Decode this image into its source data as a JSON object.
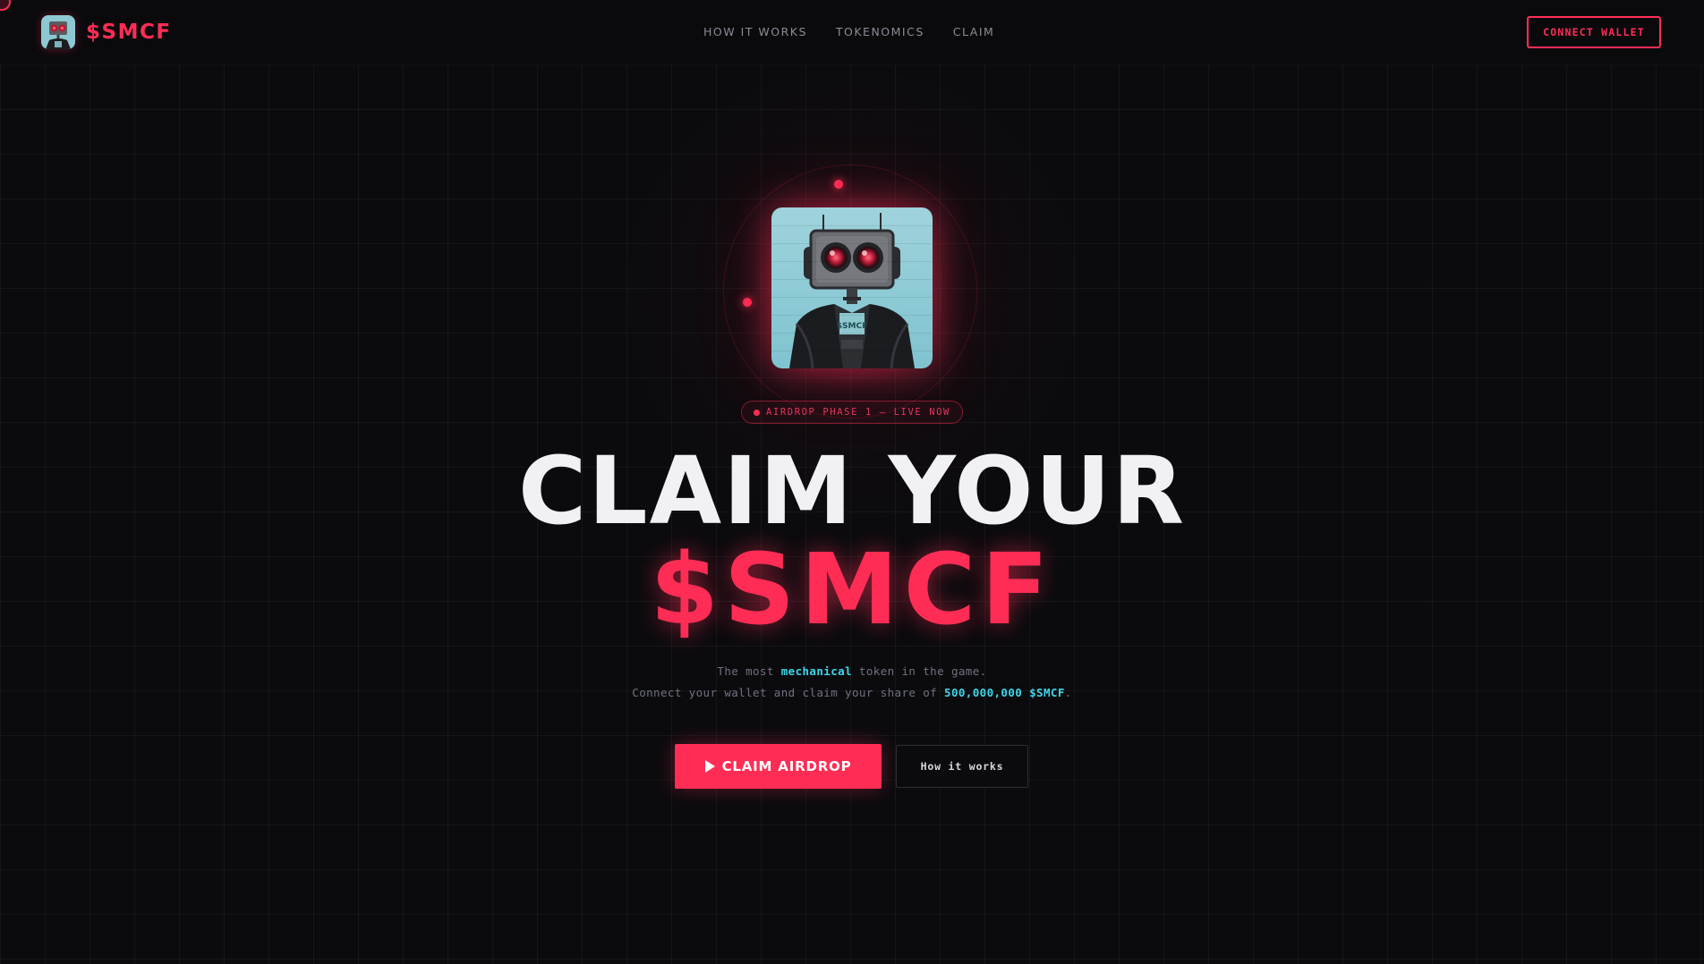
{
  "brand": {
    "name": "$SMCF"
  },
  "nav": {
    "items": [
      {
        "label": "HOW IT WORKS"
      },
      {
        "label": "TOKENOMICS"
      },
      {
        "label": "CLAIM"
      }
    ]
  },
  "header": {
    "connect_label": "CONNECT WALLET"
  },
  "hero": {
    "badge": "AIRDROP PHASE 1 — LIVE NOW",
    "avatar_text": "$SMCF",
    "title_line1": "CLAIM YOUR",
    "title_line2": "$SMCF",
    "sub_line1": {
      "before": "The most ",
      "highlight": "mechanical",
      "after": " token in the game."
    },
    "sub_line2": {
      "before": "Connect your wallet and claim your share of ",
      "highlight": "500,000,000 $SMCF",
      "after": "."
    },
    "primary_cta": "CLAIM AIRDROP",
    "secondary_cta": "How it works"
  },
  "colors": {
    "accent": "#ff2d55",
    "highlight": "#3fd6ea",
    "background": "#0b0b0e"
  },
  "icons": {
    "logo": "robot-logo-icon",
    "play": "play-icon",
    "status": "live-dot-icon"
  }
}
